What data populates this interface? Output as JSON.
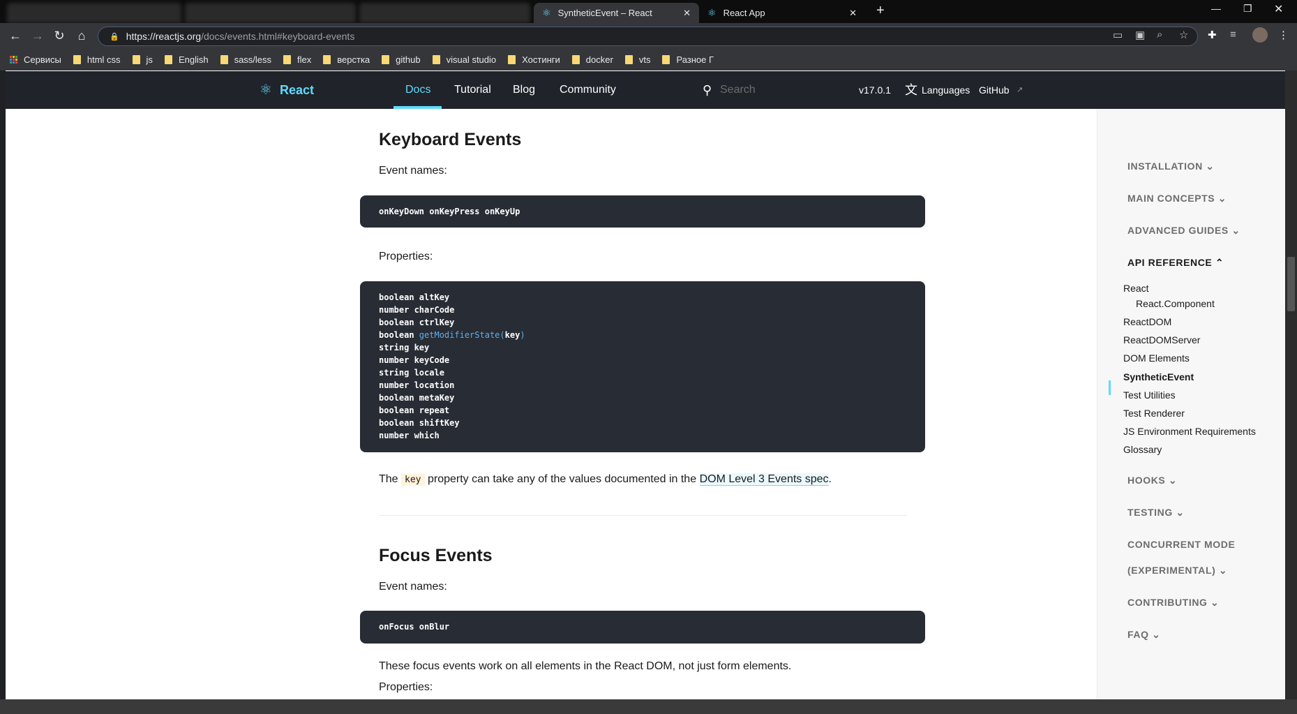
{
  "browser": {
    "tabs": [
      {
        "title": "SyntheticEvent – React",
        "active": true
      },
      {
        "title": "React App",
        "active": false
      }
    ],
    "url": {
      "host": "https://reactjs.org",
      "path": "/docs/events.html#keyboard-events"
    },
    "bookmarks": [
      "Сервисы",
      "html css",
      "js",
      "English",
      "sass/less",
      "flex",
      "верстка",
      "github",
      "visual studio",
      "Хостинги",
      "docker",
      "vts",
      "Разное Г"
    ]
  },
  "site_nav": {
    "logo": "React",
    "links": [
      "Docs",
      "Tutorial",
      "Blog",
      "Community"
    ],
    "active": "Docs",
    "search_placeholder": "Search",
    "version": "v17.0.1",
    "languages": "Languages",
    "github": "GitHub"
  },
  "content": {
    "keyboard": {
      "title": "Keyboard Events",
      "event_names_label": "Event names:",
      "event_names": "onKeyDown onKeyPress onKeyUp",
      "properties_label": "Properties:",
      "properties": [
        "boolean altKey",
        "number charCode",
        "boolean ctrlKey",
        "boolean getModifierState(key)",
        "string key",
        "number keyCode",
        "string locale",
        "number location",
        "boolean metaKey",
        "boolean repeat",
        "boolean shiftKey",
        "number which"
      ],
      "note_prefix": "The",
      "note_code": "key",
      "note_middle": "property can take any of the values documented in the",
      "note_link": "DOM Level 3 Events spec",
      "note_suffix": "."
    },
    "focus": {
      "title": "Focus Events",
      "event_names_label": "Event names:",
      "event_names": "onFocus onBlur",
      "description": "These focus events work on all elements in the React DOM, not just form elements.",
      "properties_label": "Properties:"
    }
  },
  "sidebar": {
    "sections_top": [
      "INSTALLATION",
      "MAIN CONCEPTS",
      "ADVANCED GUIDES"
    ],
    "open_section": "API REFERENCE",
    "items": [
      "React",
      "React.Component",
      "ReactDOM",
      "ReactDOMServer",
      "DOM Elements",
      "SyntheticEvent",
      "Test Utilities",
      "Test Renderer",
      "JS Environment Requirements",
      "Glossary"
    ],
    "active_item": "SyntheticEvent",
    "sections_bottom": [
      "HOOKS",
      "TESTING",
      "CONCURRENT MODE",
      "(EXPERIMENTAL)",
      "CONTRIBUTING",
      "FAQ"
    ]
  },
  "colors": {
    "accent": "#61dafb",
    "nav_bg": "#20232a",
    "code_bg": "#282c34"
  }
}
